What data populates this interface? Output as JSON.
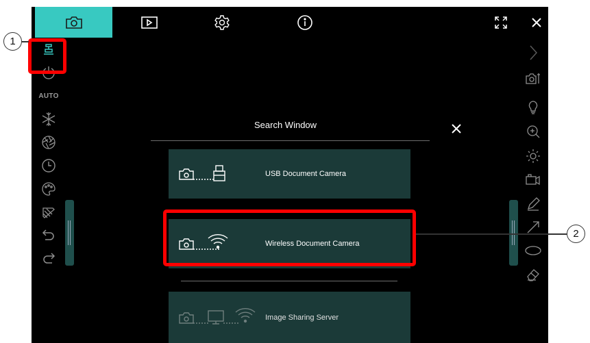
{
  "colors": {
    "accent": "#38c9c1",
    "panel": "#1b3a38",
    "highlight": "#ff0000",
    "icon": "#8f8f8f",
    "background": "#000000"
  },
  "topbar": {
    "tabs": [
      {
        "name": "camera-icon",
        "active": true
      },
      {
        "name": "playback-icon",
        "active": false
      },
      {
        "name": "settings-gear-icon",
        "active": false
      },
      {
        "name": "info-icon",
        "active": false
      }
    ],
    "right_icons": [
      "fullscreen-icon",
      "close-icon"
    ]
  },
  "left_toolbar": {
    "items": [
      "document-camera-icon",
      "power-icon",
      "auto-focus",
      "freeze-icon",
      "aperture-icon",
      "timer-icon",
      "palette-icon",
      "mask-icon",
      "undo-icon",
      "redo-icon"
    ],
    "auto_label": "AUTO"
  },
  "right_toolbar": {
    "items": [
      "chevron-right-icon",
      "camera-settings-icon",
      "lamp-icon",
      "zoom-in-icon",
      "brightness-icon",
      "record-icon",
      "pen-icon",
      "arrow-icon",
      "ellipse-icon",
      "eraser-icon"
    ]
  },
  "search_window": {
    "title": "Search Window",
    "options": [
      {
        "label": "USB Document Camera",
        "icons": [
          "camera-icon",
          "usb-icon"
        ]
      },
      {
        "label": "Wireless Document Camera",
        "icons": [
          "camera-icon",
          "wifi-icon"
        ]
      },
      {
        "label": "Image Sharing Server",
        "icons": [
          "camera-icon",
          "monitor-icon",
          "wifi-icon"
        ]
      }
    ]
  },
  "callouts": [
    {
      "number": "1",
      "target": "document-camera-button"
    },
    {
      "number": "2",
      "target": "wireless-document-camera-option"
    }
  ]
}
